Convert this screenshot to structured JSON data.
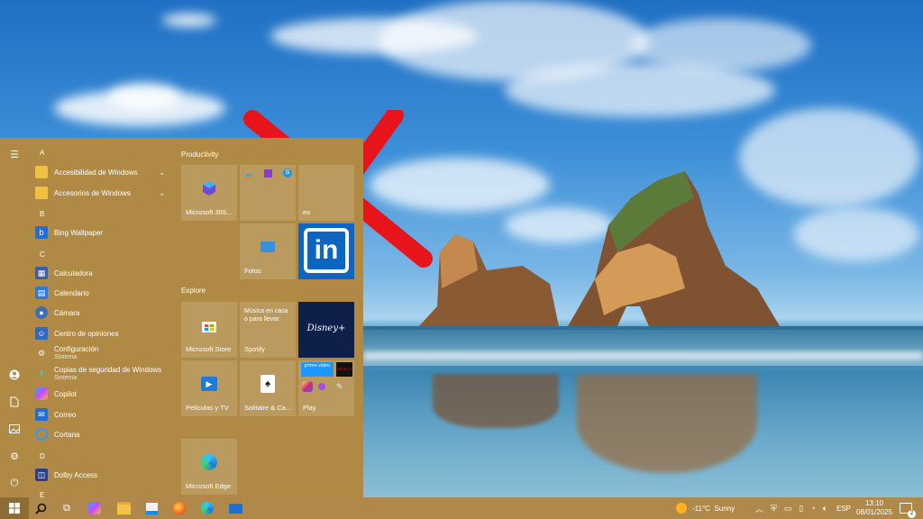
{
  "start_menu": {
    "groups": [
      {
        "letter": "A",
        "items": [
          {
            "label": "Accesibilidad de Windows",
            "icon": "folder-icon",
            "expandable": true
          },
          {
            "label": "Accesorios de Windows",
            "icon": "folder-icon",
            "expandable": true
          }
        ]
      },
      {
        "letter": "B",
        "items": [
          {
            "label": "Bing Wallpaper",
            "icon": "bing-icon"
          }
        ]
      },
      {
        "letter": "C",
        "items": [
          {
            "label": "Calculadora",
            "icon": "calculator-icon"
          },
          {
            "label": "Calendario",
            "icon": "calendar-icon"
          },
          {
            "label": "Cámara",
            "icon": "camera-icon"
          },
          {
            "label": "Centro de opiniones",
            "icon": "feedback-icon"
          },
          {
            "label": "Configuración",
            "sub": "Sistema",
            "icon": "gear-icon"
          },
          {
            "label": "Copias de seguridad de Windows",
            "sub": "Sistema",
            "icon": "backup-icon"
          },
          {
            "label": "Copilot",
            "icon": "copilot-icon"
          },
          {
            "label": "Correo",
            "icon": "mail-icon"
          },
          {
            "label": "Cortana",
            "icon": "cortana-icon"
          }
        ]
      },
      {
        "letter": "D",
        "items": [
          {
            "label": "Dolby Access",
            "icon": "dolby-icon"
          }
        ]
      },
      {
        "letter": "E",
        "items": []
      }
    ],
    "tile_groups": {
      "productivity": "Productivity",
      "explore": "Explore"
    },
    "tiles": {
      "microsoft365": "Microsoft 365...",
      "video_partial": "eo",
      "fotos": "Fotos",
      "store": "Microsoft Store",
      "spotify": "Spotify",
      "spotify_promo": "Música en casa o para llevar.",
      "disney": "Disney+",
      "peliculas": "Películas y TV",
      "solitaire": "Solitaire & Ca...",
      "play": "Play",
      "edge": "Microsoft Edge",
      "linkedin": "in",
      "prime": "prime video",
      "netflix": "NETFLIX"
    }
  },
  "taskbar": {
    "weather_temp": "-11°C",
    "weather_cond": "Sunny",
    "language": "ESP",
    "time": "13:10",
    "date": "08/01/2025",
    "notifications": "2"
  },
  "colors": {
    "menu": "#b08a45",
    "annotation_x": "#e8141c"
  }
}
